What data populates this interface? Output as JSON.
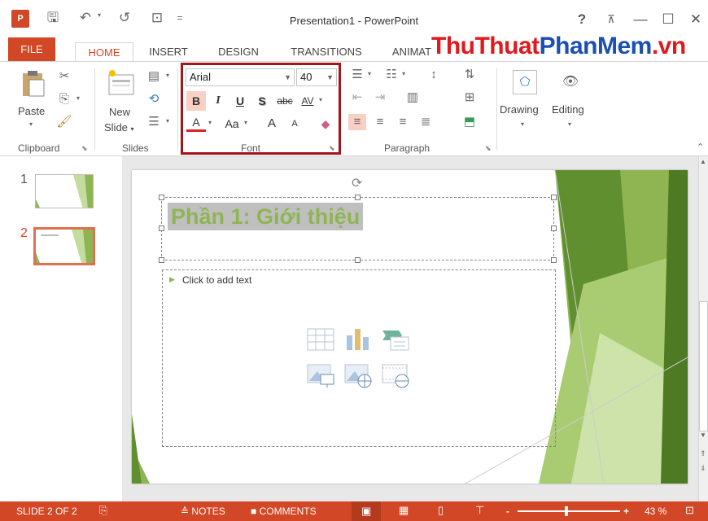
{
  "titlebar": {
    "title": "Presentation1 - PowerPoint",
    "logo": "P",
    "help": "?",
    "icons": [
      "save-icon",
      "undo-icon",
      "redo-icon",
      "start-slideshow-icon",
      "customize-qat-icon"
    ]
  },
  "tabs": [
    "FILE",
    "HOME",
    "INSERT",
    "DESIGN",
    "TRANSITIONS",
    "ANIMAT"
  ],
  "watermark": {
    "part1": "ThuThuat",
    "part2": "PhanMem",
    "part3": ".vn"
  },
  "ribbon": {
    "clipboard": {
      "label": "Clipboard",
      "paste": "Paste"
    },
    "slides": {
      "label": "Slides",
      "new": "New",
      "slide": "Slide"
    },
    "font": {
      "label": "Font",
      "name": "Arial",
      "size": "40",
      "bold": "B",
      "italic": "I",
      "underline": "U",
      "shadow": "S",
      "strike": "abc",
      "spacing": "AV",
      "color": "A",
      "case": "Aa",
      "grow": "A",
      "shrink": "A"
    },
    "paragraph": {
      "label": "Paragraph"
    },
    "drawing": {
      "label": "Drawing"
    },
    "editing": {
      "label": "Editing"
    }
  },
  "slides_panel": [
    {
      "num": "1",
      "selected": false
    },
    {
      "num": "2",
      "selected": true
    }
  ],
  "slide": {
    "title": "Phần 1: Giới thiệu",
    "placeholder": "Click to add text"
  },
  "statusbar": {
    "slide_info": "SLIDE 2 OF 2",
    "notes": "NOTES",
    "comments": "COMMENTS",
    "zoom": "43 %",
    "zoom_minus": "-",
    "zoom_plus": "+"
  },
  "colors": {
    "accent": "#d24726",
    "green": "#8fb552",
    "highlight": "#a3141b"
  }
}
